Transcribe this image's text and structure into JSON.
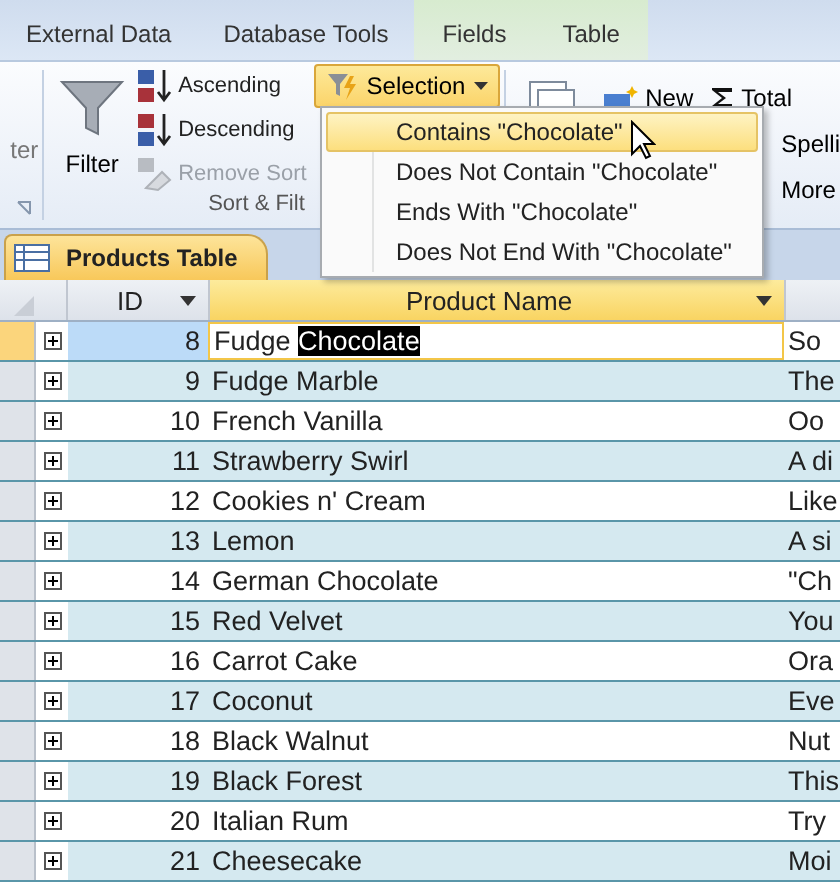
{
  "ribbon_tabs": [
    {
      "label": "External Data",
      "kind": "main"
    },
    {
      "label": "Database Tools",
      "kind": "main"
    },
    {
      "label": "Fields",
      "kind": "contextual"
    },
    {
      "label": "Table",
      "kind": "contextual"
    }
  ],
  "ribbon": {
    "cut_group_label": "ter",
    "sort_filter": {
      "filter_button": "Filter",
      "sort_buttons": [
        {
          "label": "Ascending",
          "kind": "ascending",
          "disabled": false
        },
        {
          "label": "Descending",
          "kind": "descending",
          "disabled": false
        },
        {
          "label": "Remove Sort",
          "kind": "remove",
          "disabled": true
        }
      ],
      "selection_button": {
        "label": "Selection",
        "open": true
      },
      "group_label": "Sort & Filt"
    },
    "records": {
      "new_button": "New",
      "totals_button": "Total",
      "spelling_button": "Spelli",
      "more_button": "More"
    }
  },
  "selection_menu": [
    {
      "label": "Contains \"Chocolate\"",
      "selected": true
    },
    {
      "label": "Does Not Contain \"Chocolate\"",
      "selected": false
    },
    {
      "label": "Ends With \"Chocolate\"",
      "selected": false
    },
    {
      "label": "Does Not End With \"Chocolate\"",
      "selected": false
    }
  ],
  "document_tab": "Products Table",
  "table": {
    "columns": [
      {
        "label": "ID",
        "selected": false
      },
      {
        "label": "Product Name",
        "selected": true
      }
    ],
    "rows": [
      {
        "id": "8",
        "name": "Fudge ",
        "selected_text": "Chocolate",
        "column_3": "So",
        "selected": true
      },
      {
        "id": "9",
        "name": "Fudge Marble",
        "column_3": "The",
        "selected": false
      },
      {
        "id": "10",
        "name": "French Vanilla",
        "column_3": "Oo",
        "selected": false
      },
      {
        "id": "11",
        "name": "Strawberry Swirl",
        "column_3": "A di",
        "selected": false
      },
      {
        "id": "12",
        "name": "Cookies n' Cream",
        "column_3": "Like",
        "selected": false
      },
      {
        "id": "13",
        "name": "Lemon",
        "column_3": "A si",
        "selected": false
      },
      {
        "id": "14",
        "name": "German Chocolate",
        "column_3": "\"Ch",
        "selected": false
      },
      {
        "id": "15",
        "name": "Red Velvet",
        "column_3": "You",
        "selected": false
      },
      {
        "id": "16",
        "name": "Carrot Cake",
        "column_3": "Ora",
        "selected": false
      },
      {
        "id": "17",
        "name": "Coconut",
        "column_3": "Eve",
        "selected": false
      },
      {
        "id": "18",
        "name": "Black Walnut",
        "column_3": "Nut",
        "selected": false
      },
      {
        "id": "19",
        "name": "Black Forest",
        "column_3": "This",
        "selected": false
      },
      {
        "id": "20",
        "name": "Italian Rum",
        "column_3": "Try",
        "selected": false
      },
      {
        "id": "21",
        "name": "Cheesecake",
        "column_3": "Moi",
        "selected": false
      }
    ]
  }
}
